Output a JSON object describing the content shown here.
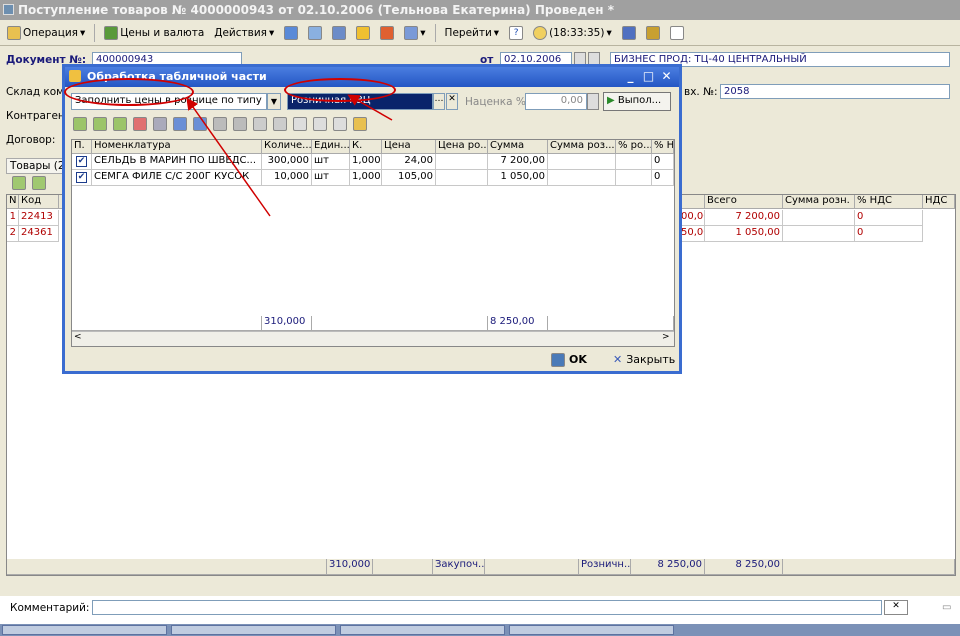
{
  "window": {
    "title": "Поступление товаров № 4000000943 от 02.10.2006 (Тельнова Екатерина) Проведен *"
  },
  "toolbar": {
    "operation": "Операция",
    "prices_currency": "Цены и валюта",
    "actions": "Действия",
    "goto": "Перейти",
    "help": "?",
    "time": "(18:33:35)"
  },
  "doc": {
    "number_label": "Документ №:",
    "number_value": "400000943",
    "from_label": "от",
    "date_value": "02.10.2006",
    "org_value": "БИЗНЕС ПРОД: ТЦ-40 ЦЕНТРАЛЬНЫЙ",
    "warehouse_label": "Склад ком",
    "contractor_label": "Контрагент",
    "contract_label": "Договор:",
    "inc_num_label": "вх. №:",
    "inc_num_value": "2058",
    "goods_tab": "Товары (2"
  },
  "main_table": {
    "headers": [
      "N",
      "Код",
      "Всего",
      "Сумма розн.",
      "% НДС",
      "НДС"
    ],
    "rows": [
      {
        "n": "1",
        "code": "22413",
        "partial": "00,00",
        "total": "7 200,00",
        "vat_pct": "0"
      },
      {
        "n": "2",
        "code": "24361",
        "partial": "50,00",
        "total": "1 050,00",
        "vat_pct": "0"
      }
    ],
    "footer": {
      "qty": "310,000",
      "purchase": "Закупоч...",
      "retail": "Розничн...",
      "sum1": "8 250,00",
      "sum2": "8 250,00"
    }
  },
  "comment": {
    "label": "Комментарий:",
    "value": ""
  },
  "dialog": {
    "title": "Обработка табличной части",
    "action_select": "Заполнить цены в рознице по типу",
    "price_type": "Розничная КЗЦ",
    "markup_label": "Наценка %",
    "markup_value": "0,00",
    "run_button": "Выпол...",
    "headers": [
      "П.",
      "Номенклатура",
      "Количе...",
      "Един...",
      "К.",
      "Цена",
      "Цена ро...",
      "Сумма",
      "Сумма роз...",
      "% ро...",
      "% НДС"
    ],
    "rows": [
      {
        "name": "СЕЛЬДЬ В МАРИН ПО ШВЕДС...",
        "qty": "300,000",
        "unit": "шт",
        "k": "1,000",
        "price": "24,00",
        "sum": "7 200,00",
        "vat": "0"
      },
      {
        "name": "СЕМГА ФИЛЕ С/С 200Г КУСОК",
        "qty": "10,000",
        "unit": "шт",
        "k": "1,000",
        "price": "105,00",
        "sum": "1 050,00",
        "vat": "0"
      }
    ],
    "footer_qty": "310,000",
    "footer_sum": "8 250,00",
    "ok": "OK",
    "close": "Закрыть"
  },
  "colors": {
    "annotation": "#d00000",
    "dialog_border": "#3a6cd0"
  }
}
